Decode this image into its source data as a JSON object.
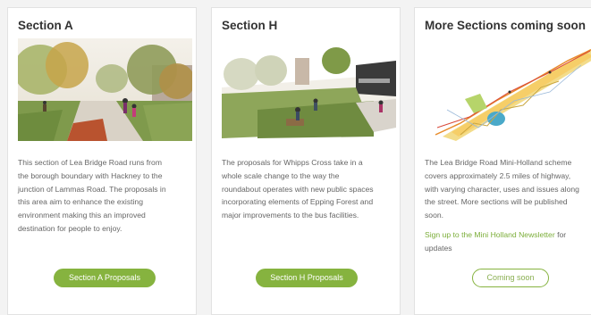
{
  "cards": [
    {
      "title": "Section A",
      "body": [
        "This section of Lea Bridge Road runs from",
        "the borough boundary with Hackney to the",
        "junction of Lammas Road. The proposals in",
        "this area aim to enhance the existing",
        "environment making this an improved",
        "destination for people to enjoy."
      ],
      "button": "Section A Proposals"
    },
    {
      "title": "Section H",
      "body": [
        "The proposals for Whipps Cross take in a",
        "whole scale change to the way the",
        "roundabout operates with new public spaces",
        "incorporating elements of Epping Forest and",
        "major improvements to the bus facilities."
      ],
      "button": "Section H Proposals"
    },
    {
      "title": "More Sections coming soon",
      "body": [
        "The Lea Bridge Road Mini-Holland scheme",
        "covers approximately 2.5 miles of highway,",
        "with varying character, uses and issues along",
        "the street. More sections will be published",
        "soon."
      ],
      "link_text": "Sign up to the Mini Holland Newsletter",
      "link_suffix": " for",
      "link_line2": "updates",
      "button": "Coming soon"
    }
  ],
  "colors": {
    "accent": "#86b33f",
    "link": "#7cae3a",
    "text": "#666666",
    "title": "#333333"
  }
}
